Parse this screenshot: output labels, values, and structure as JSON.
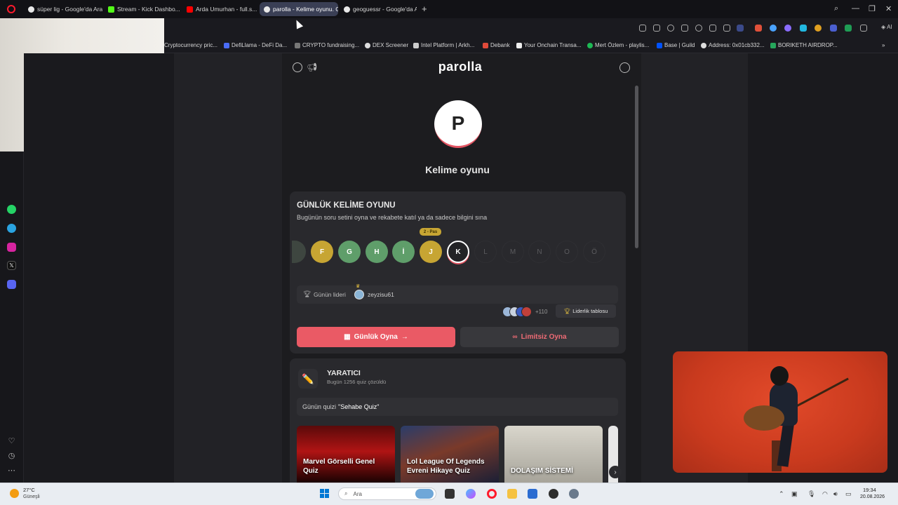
{
  "browser": {
    "tabs": [
      {
        "label": "süper lig - Google'da Ara"
      },
      {
        "label": "Stream - Kick Dashbo..."
      },
      {
        "label": "Arda Umurhan - full.s..."
      },
      {
        "label": "parolla - Kelime oyunu. G..."
      },
      {
        "label": "geoguessr - Google'da Ar..."
      }
    ],
    "new_tab_label": "+",
    "bookmarks": [
      "Cryptocurrency pric...",
      "DefiLlama - DeFi Da...",
      "CRYPTO fundraising...",
      "DEX Screener",
      "Intel Platform | Arkh...",
      "Debank",
      "Your Onchain Transa...",
      "Mert Özlem - playlis...",
      "Base | Guild",
      "Address: 0x01cb332...",
      "BORIKETH AIRDROP..."
    ],
    "ai_label": "AI"
  },
  "app": {
    "brand": "parolla",
    "avatar_letter": "P",
    "subtitle": "Kelime oyunu",
    "daily": {
      "title": "GÜNLÜK KELİME OYUNU",
      "description": "Bugünün soru setini oyna ve rekabete katıl ya da sadece bilgini sına",
      "pass_badge": "2 - Pas",
      "letters": [
        {
          "l": "F",
          "state": "done-yellow"
        },
        {
          "l": "G",
          "state": "done-green"
        },
        {
          "l": "H",
          "state": "done-green"
        },
        {
          "l": "İ",
          "state": "done-green"
        },
        {
          "l": "J",
          "state": "done-yellow"
        },
        {
          "l": "K",
          "state": "current"
        },
        {
          "l": "L",
          "state": "dim"
        },
        {
          "l": "M",
          "state": "dim"
        },
        {
          "l": "N",
          "state": "dim"
        },
        {
          "l": "O",
          "state": "dim"
        },
        {
          "l": "Ö",
          "state": "dim"
        }
      ],
      "leader_label": "Günün lideri",
      "leader_name": "zeyzisu61",
      "players_more": "+110",
      "leaderboard_label": "Liderlik tablosu",
      "play_daily": "Günlük Oyna",
      "play_unlimited": "Limitsiz Oyna"
    },
    "creator": {
      "title": "YARATICI",
      "subtitle": "Bugün 1256 quiz çözüldü",
      "quiz_of_day_prefix": "Günün quizi",
      "quiz_of_day_name": "\"Sehabe Quiz\"",
      "cards": [
        {
          "label": "Marvel Görselli Genel Quiz"
        },
        {
          "label": "Lol League Of Legends Evreni Hikaye Quiz"
        },
        {
          "label": "DOLAŞIM SİSTEMİ"
        }
      ]
    }
  },
  "taskbar": {
    "weather_temp": "27°C",
    "weather_desc": "Güneşli",
    "search_placeholder": "Ara",
    "time": "19:34",
    "date": "20.08.2026"
  },
  "colors": {
    "accent": "#ea5a65",
    "correct": "#5f9e6a",
    "pass": "#c7a533"
  }
}
